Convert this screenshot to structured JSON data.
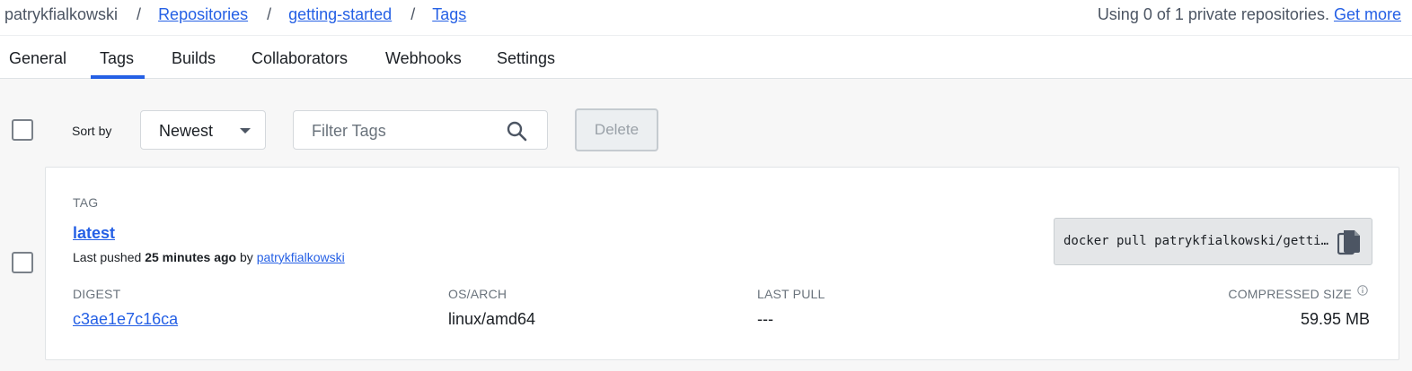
{
  "breadcrumb": {
    "owner": "patrykfialkowski",
    "separator": "/",
    "repositories": "Repositories",
    "repo": "getting-started",
    "current": "Tags"
  },
  "usage": {
    "text": "Using 0 of 1 private repositories.",
    "link": "Get more"
  },
  "tabs": [
    {
      "label": "General"
    },
    {
      "label": "Tags",
      "active": true
    },
    {
      "label": "Builds"
    },
    {
      "label": "Collaborators"
    },
    {
      "label": "Webhooks"
    },
    {
      "label": "Settings"
    }
  ],
  "toolbar": {
    "sort_label": "Sort by",
    "sort_value": "Newest",
    "filter_placeholder": "Filter Tags",
    "delete_label": "Delete"
  },
  "tag": {
    "section_label": "TAG",
    "name": "latest",
    "pushed_prefix": "Last pushed",
    "pushed_time": "25 minutes ago",
    "pushed_by": "by",
    "pushed_user": "patrykfialkowski",
    "pull_command": "docker pull patrykfialkowski/getting-started:latest",
    "columns": {
      "digest": "DIGEST",
      "os_arch": "OS/ARCH",
      "last_pull": "LAST PULL",
      "size": "COMPRESSED SIZE"
    },
    "digest": "c3ae1e7c16ca",
    "os_arch": "linux/amd64",
    "last_pull": "---",
    "size": "59.95 MB"
  },
  "colors": {
    "link": "#2560e5",
    "active_tab": "#2560e5"
  }
}
